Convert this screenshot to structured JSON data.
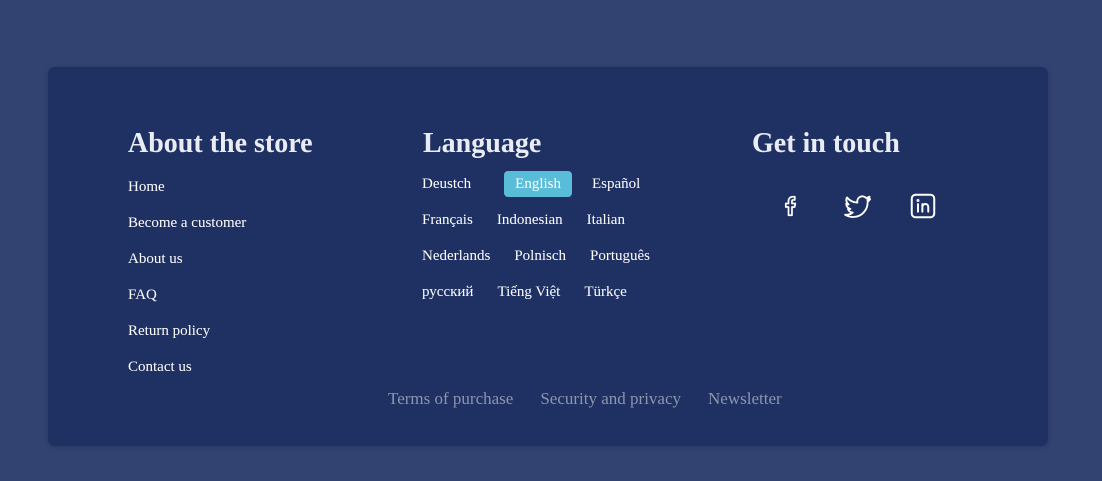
{
  "about": {
    "title": "About the store",
    "items": [
      "Home",
      "Become a customer",
      "About us",
      "FAQ",
      "Return policy",
      "Contact us"
    ]
  },
  "language": {
    "title": "Language",
    "selected": "English",
    "rows": [
      [
        "Deustch",
        "English",
        "Español"
      ],
      [
        "Français",
        "Indonesian",
        "Italian"
      ],
      [
        "Nederlands",
        "Polnisch",
        "Português"
      ],
      [
        "русский",
        "Tiếng Việt",
        "Türkçe"
      ]
    ]
  },
  "contact": {
    "title": "Get in touch",
    "social_icons": [
      "facebook-icon",
      "twitter-icon",
      "linkedin-icon"
    ]
  },
  "bottom_links": [
    "Terms of purchase",
    "Security and privacy",
    "Newsletter"
  ],
  "colors": {
    "page_background": "#324372",
    "card_background": "#1f3163",
    "active_language": "#59bcd8",
    "muted_link": "#8c95ad"
  }
}
